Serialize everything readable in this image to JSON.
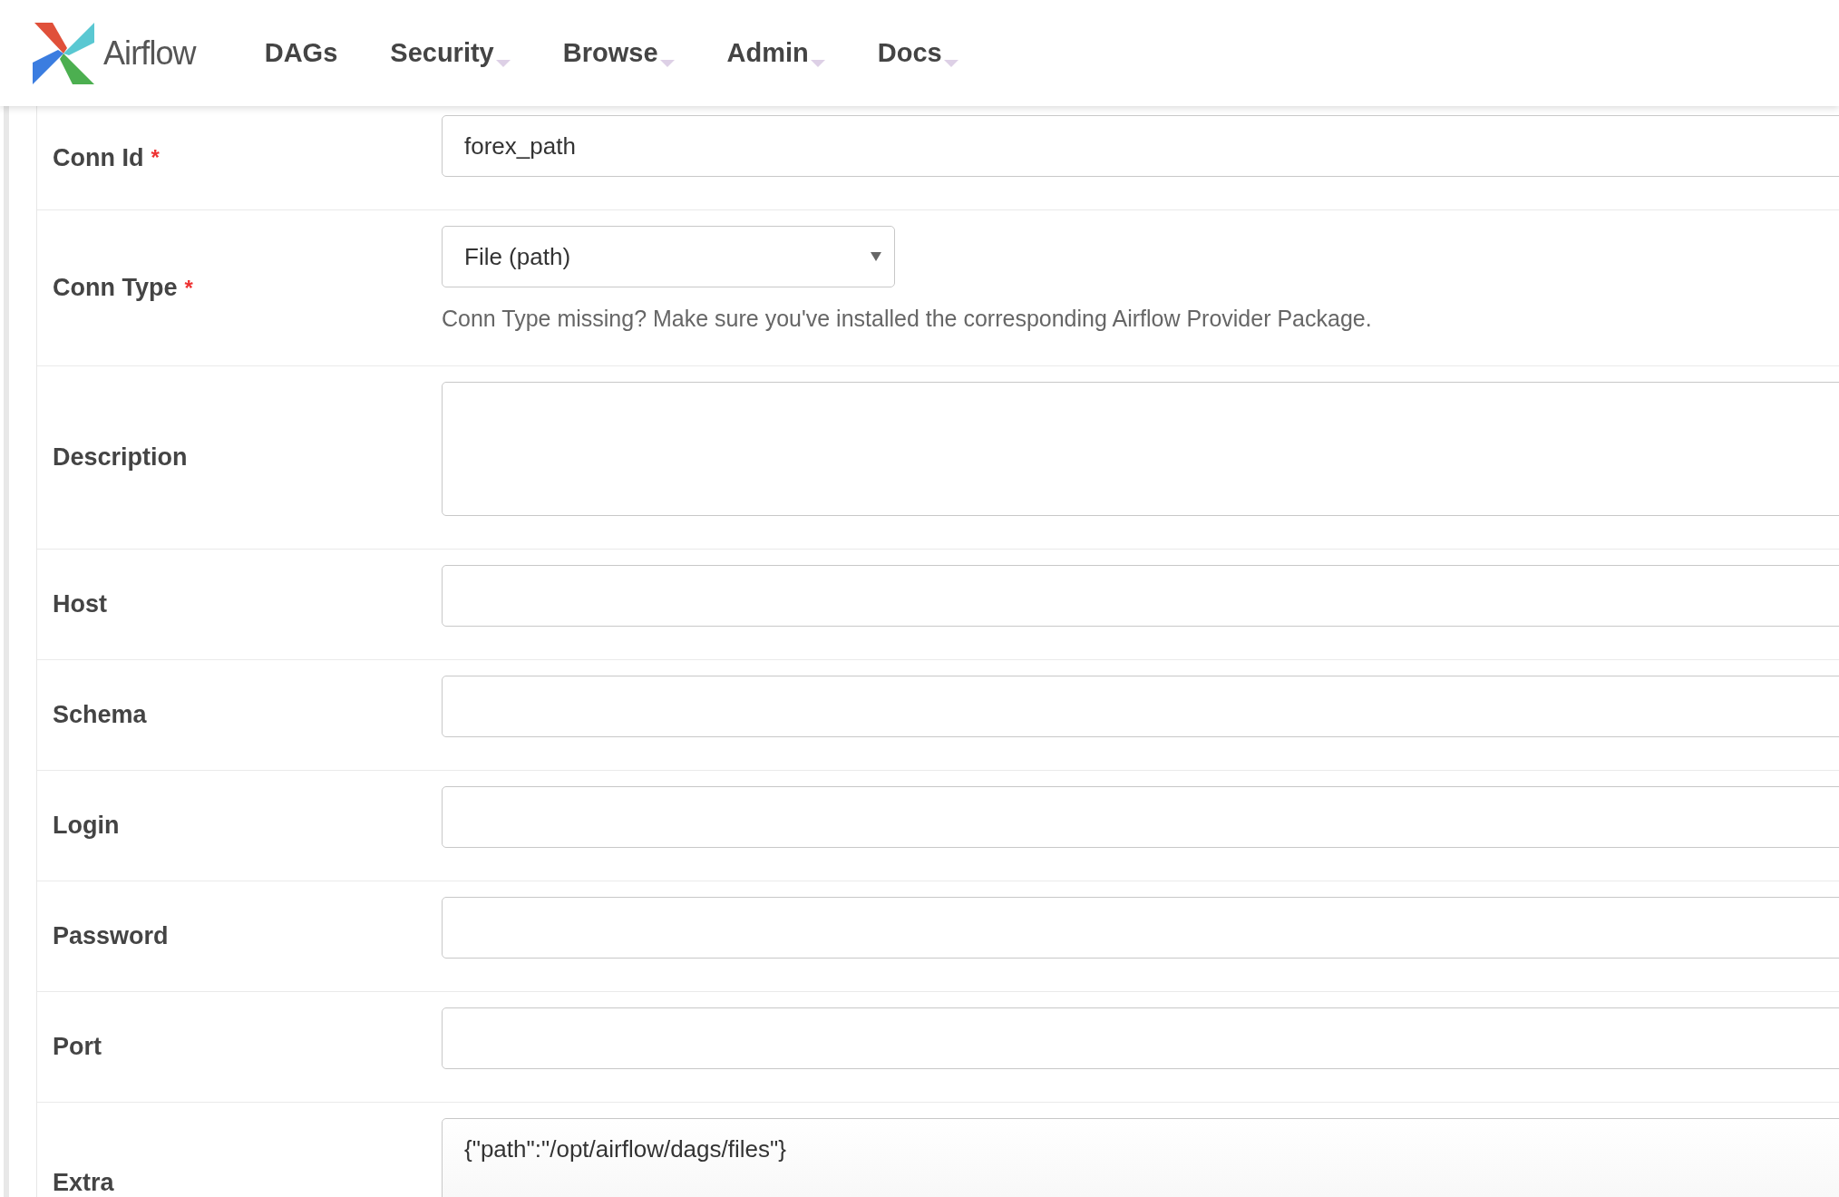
{
  "brand": {
    "name": "Airflow"
  },
  "nav": [
    {
      "label": "DAGs",
      "dropdown": false
    },
    {
      "label": "Security",
      "dropdown": true
    },
    {
      "label": "Browse",
      "dropdown": true
    },
    {
      "label": "Admin",
      "dropdown": true
    },
    {
      "label": "Docs",
      "dropdown": true
    }
  ],
  "required_mark": "*",
  "fields": [
    {
      "label": "Conn Id",
      "kind": "text",
      "required": true,
      "value": "forex_path"
    },
    {
      "label": "Conn Type",
      "kind": "select",
      "required": true,
      "value": "File (path)",
      "help": "Conn Type missing? Make sure you've installed the corresponding Airflow Provider Package."
    },
    {
      "label": "Description",
      "kind": "textarea",
      "required": false
    },
    {
      "label": "Host",
      "kind": "text",
      "required": false
    },
    {
      "label": "Schema",
      "kind": "text",
      "required": false
    },
    {
      "label": "Login",
      "kind": "text",
      "required": false
    },
    {
      "label": "Password",
      "kind": "text",
      "required": false
    },
    {
      "label": "Port",
      "kind": "text",
      "required": false
    },
    {
      "label": "Extra",
      "kind": "extra",
      "required": false,
      "value": "{\"path\":\"/opt/airflow/dags/files\"}"
    }
  ]
}
